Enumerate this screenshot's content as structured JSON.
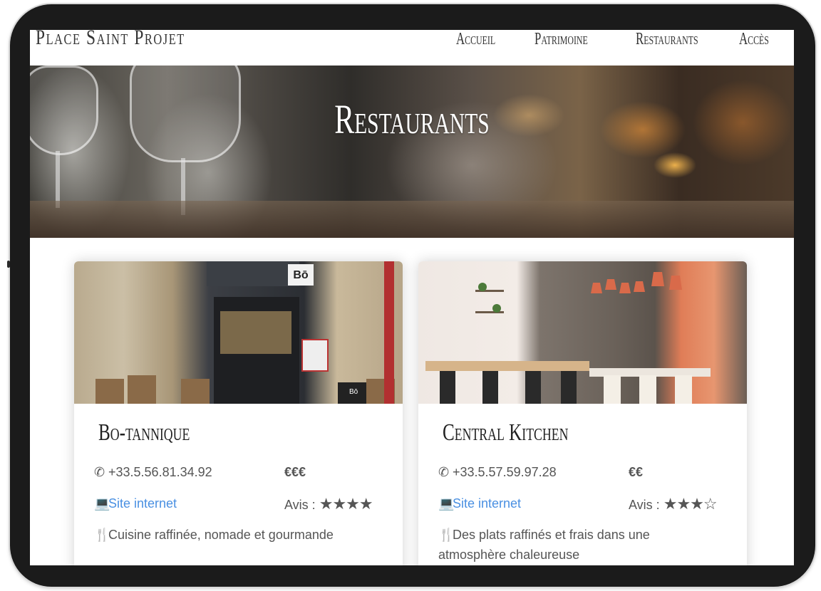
{
  "brand": "Place Saint Projet",
  "nav": [
    {
      "label": "Accueil"
    },
    {
      "label": "Patrimoine"
    },
    {
      "label": "Restaurants"
    },
    {
      "label": "Accès"
    }
  ],
  "hero": {
    "title": "Restaurants"
  },
  "cards": [
    {
      "name": "Bo-tannique",
      "phone": "+33.5.56.81.34.92",
      "price": "€€€",
      "website_label": "Site internet",
      "reviews_label": "Avis :",
      "rating": 4,
      "rating_max": 4,
      "description": "Cuisine raffinée, nomade et gourmande",
      "sign_text": "Bō",
      "sign_text2": "Bō"
    },
    {
      "name": "Central Kitchen",
      "phone": "+33.5.57.59.97.28",
      "price": "€€",
      "website_label": "Site internet",
      "reviews_label": "Avis :",
      "rating": 3,
      "rating_max": 4,
      "description_line1": "Des plats raffinés et frais dans une",
      "description_line2": "atmosphère chaleureuse"
    }
  ]
}
